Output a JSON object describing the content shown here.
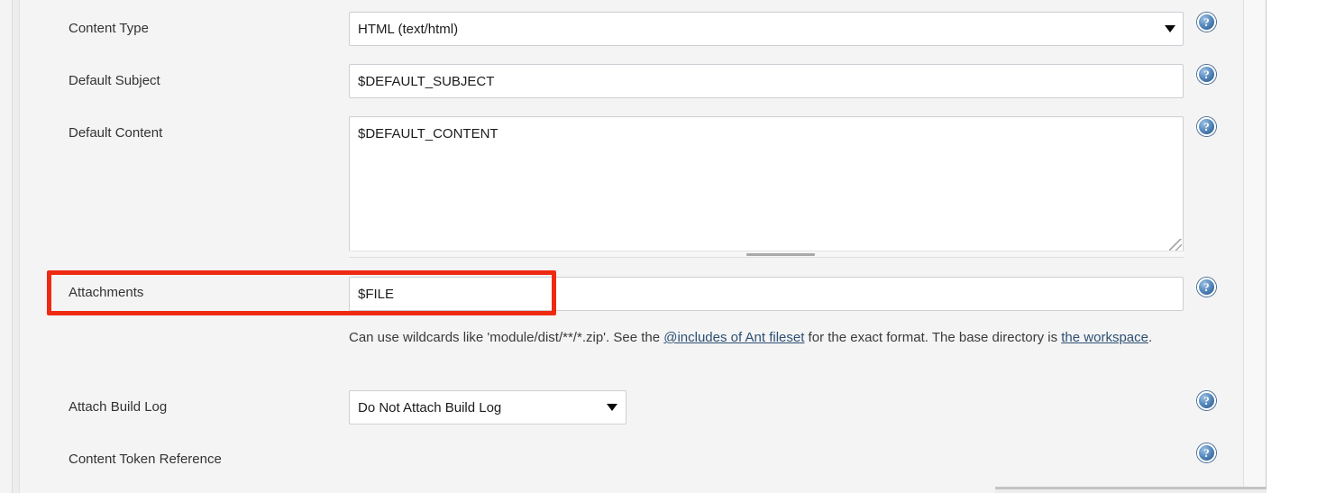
{
  "form": {
    "rows": [
      {
        "id": "content-type",
        "label": "Content Type",
        "control": "select",
        "value": "HTML (text/html)",
        "help_icon": "help-icon"
      },
      {
        "id": "default-subject",
        "label": "Default Subject",
        "control": "input",
        "value": "$DEFAULT_SUBJECT",
        "help_icon": "help-icon"
      },
      {
        "id": "default-content",
        "label": "Default Content",
        "control": "textarea",
        "value": "$DEFAULT_CONTENT",
        "help_icon": "help-icon"
      },
      {
        "id": "attachments",
        "label": "Attachments",
        "control": "input",
        "value": "$FILE",
        "help_icon": "help-icon",
        "highlighted": true
      },
      {
        "id": "attach-build-log",
        "label": "Attach Build Log",
        "control": "select",
        "value": "Do Not Attach Build Log",
        "help_icon": "help-icon"
      },
      {
        "id": "content-token-reference",
        "label": "Content Token Reference",
        "control": "none",
        "value": "",
        "help_icon": "help-icon"
      }
    ],
    "attachments_description": {
      "part1": "Can use wildcards like 'module/dist/**/*.zip'. See the ",
      "link1": "@includes of Ant fileset",
      "part2": " for the exact format. The base directory is ",
      "link2": "the workspace",
      "part3": "."
    },
    "help_badge_glyph": "?"
  },
  "annotation": {
    "color": "#ef2a13",
    "target": "attachments-row"
  }
}
